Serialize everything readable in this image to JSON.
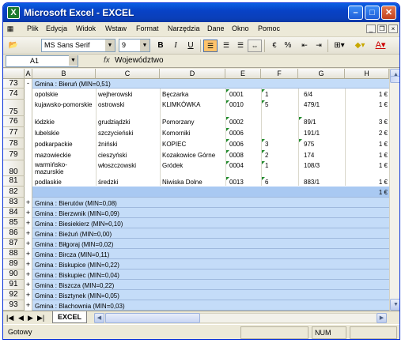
{
  "window": {
    "title": "Microsoft Excel - EXCEL"
  },
  "menu": {
    "items": [
      "Plik",
      "Edycja",
      "Widok",
      "Wstaw",
      "Format",
      "Narzędzia",
      "Dane",
      "Okno",
      "Pomoc"
    ]
  },
  "toolbar": {
    "font": "MS Sans Serif",
    "size": "9",
    "bold": "B",
    "italic": "I",
    "underline": "U",
    "percent": "%"
  },
  "formula": {
    "cell_ref": "A1",
    "fx": "fx",
    "value": "Województwo"
  },
  "columns": [
    "A",
    "B",
    "C",
    "D",
    "E",
    "F",
    "G",
    "H"
  ],
  "rows": [
    {
      "num": "73",
      "outline": "-",
      "group": "Gmina : Bieruń (MIN=0,51)"
    },
    {
      "num": "74",
      "B": "opolskie",
      "C": "wejherowski",
      "D": "Bęczarka",
      "E": "0001",
      "F": "1",
      "G": "6/4",
      "H": "1 €"
    },
    {
      "num": "75",
      "B": "kujawsko-pomorskie",
      "C": "ostrowski",
      "D": "KLIMKÓWKA",
      "E": "0010",
      "F": "5",
      "G": "479/1",
      "H": "1 €"
    },
    {
      "num": "76",
      "B": "łódzkie",
      "C": "grudziądzki",
      "D": "Pomorzany",
      "E": "0002",
      "F": "",
      "G": "89/1",
      "H": "3 €"
    },
    {
      "num": "77",
      "B": "lubelskie",
      "C": "szczycieński",
      "D": "Komorniki",
      "E": "0006",
      "F": "",
      "G": "191/1",
      "H": "2 €"
    },
    {
      "num": "78",
      "B": "podkarpackie",
      "C": "żniński",
      "D": "KOPIEC",
      "E": "0006",
      "F": "3",
      "G": "975",
      "H": "1 €"
    },
    {
      "num": "79",
      "B": "mazowieckie",
      "C": "cieszyński",
      "D": "Kozakowice Górne",
      "E": "0008",
      "F": "2",
      "G": "174",
      "H": "1 €"
    },
    {
      "num": "80",
      "B": "warmińsko-mazurskie",
      "C": "włoszczowski",
      "D": "Gródek",
      "E": "0004",
      "F": "1",
      "G": "108/3",
      "H": "1 €"
    },
    {
      "num": "81",
      "B": "podlaskie",
      "C": "średzki",
      "D": "Niwiska Dolne",
      "E": "0013",
      "F": "6",
      "G": "883/1",
      "H": "1 €"
    },
    {
      "num": "82",
      "subtotal": "1 €"
    },
    {
      "num": "83",
      "outline": "+",
      "group": "Gmina : Bierutów (MIN=0,08)"
    },
    {
      "num": "84",
      "outline": "+",
      "group": "Gmina : Bierzwnik (MIN=0,09)"
    },
    {
      "num": "85",
      "outline": "+",
      "group": "Gmina : Biesiekierz (MIN=0,10)"
    },
    {
      "num": "86",
      "outline": "+",
      "group": "Gmina : Bieżuń (MIN=0,00)"
    },
    {
      "num": "87",
      "outline": "+",
      "group": "Gmina : Biłgoraj (MIN=0,02)"
    },
    {
      "num": "88",
      "outline": "+",
      "group": "Gmina : Bircza (MIN=0,11)"
    },
    {
      "num": "89",
      "outline": "+",
      "group": "Gmina : Biskupice (MIN=0,22)"
    },
    {
      "num": "90",
      "outline": "+",
      "group": "Gmina : Biskupiec (MIN=0,04)"
    },
    {
      "num": "91",
      "outline": "+",
      "group": "Gmina : Biszcza (MIN=0,22)"
    },
    {
      "num": "92",
      "outline": "+",
      "group": "Gmina : Bisztynek (MIN=0,05)"
    },
    {
      "num": "93",
      "outline": "+",
      "group": "Gmina : Blachownia (MIN=0,03)"
    }
  ],
  "sheet": {
    "tab": "EXCEL"
  },
  "status": {
    "text": "Gotowy",
    "num": "NUM"
  },
  "colors": {
    "titlebar": "#0842c6",
    "group_band": "#c4dcf8",
    "active_button": "#ffc36b"
  }
}
